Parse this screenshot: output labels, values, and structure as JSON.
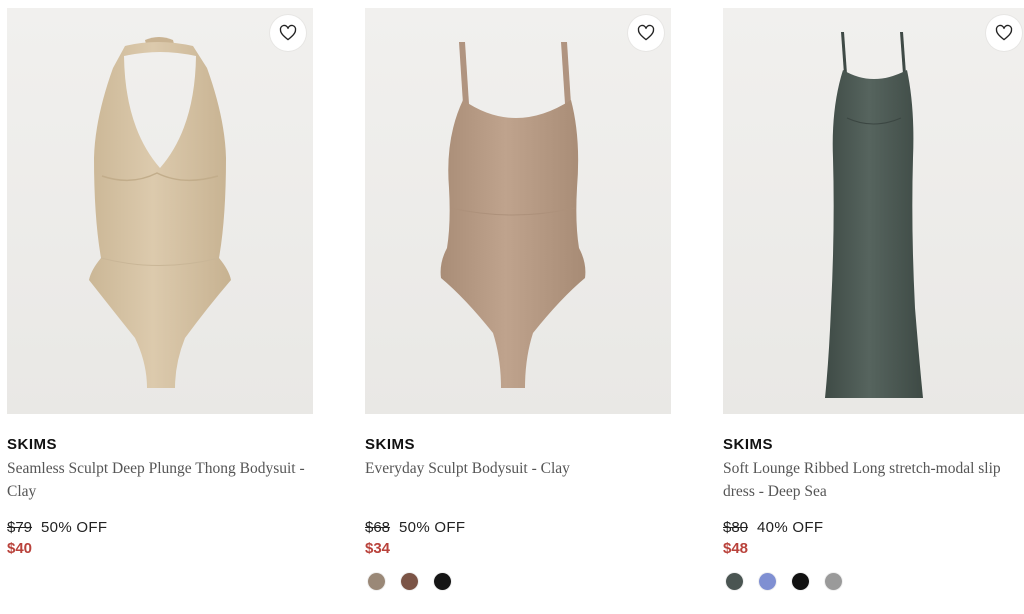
{
  "products": [
    {
      "brand": "SKIMS",
      "name": "Seamless Sculpt Deep Plunge Thong Bodysuit - Clay",
      "original_price": "$79",
      "discount": "50% OFF",
      "sale_price": "$40",
      "wishlist_icon": "heart-outline-icon",
      "product_color": "#d7c4a6",
      "swatches": []
    },
    {
      "brand": "SKIMS",
      "name": "Everyday Sculpt Bodysuit - Clay",
      "original_price": "$68",
      "discount": "50% OFF",
      "sale_price": "$34",
      "wishlist_icon": "heart-outline-icon",
      "product_color": "#b79a84",
      "swatches": [
        "#9a8877",
        "#7b5446",
        "#151515"
      ]
    },
    {
      "brand": "SKIMS",
      "name": "Soft Lounge Ribbed Long stretch-modal slip dress - Deep Sea",
      "original_price": "$80",
      "discount": "40% OFF",
      "sale_price": "$48",
      "wishlist_icon": "heart-outline-icon",
      "product_color": "#4d5b55",
      "swatches": [
        "#4a5552",
        "#7f8fd2",
        "#111111",
        "#9a9a9a"
      ]
    }
  ],
  "colors": {
    "sale": "#b9423b",
    "image_bg": "#eeedea"
  }
}
